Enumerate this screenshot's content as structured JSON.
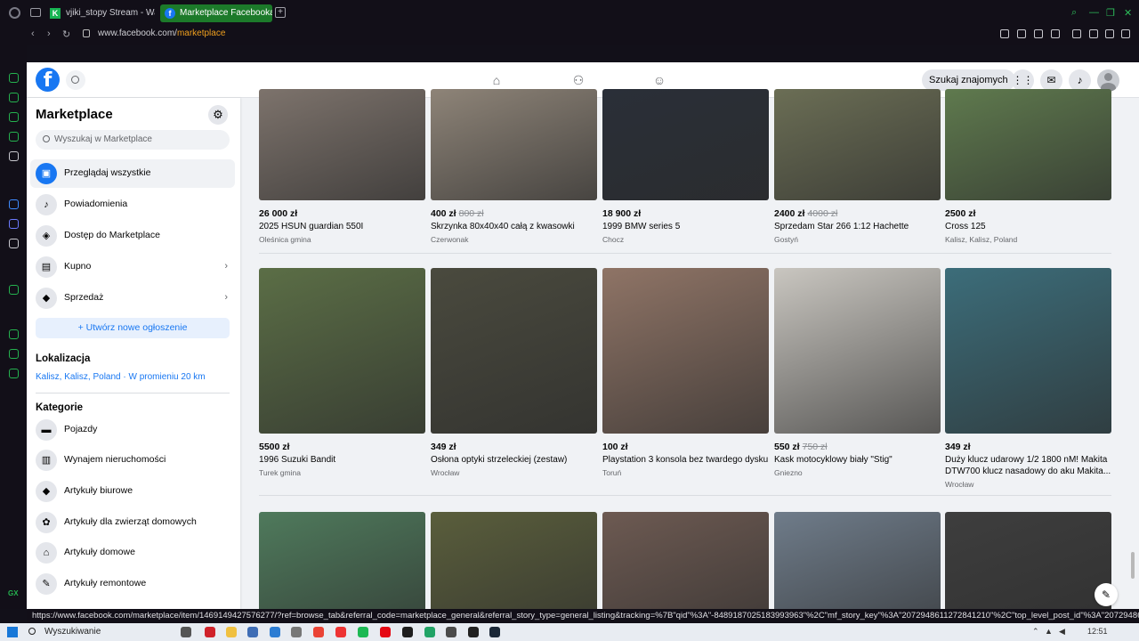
{
  "browser": {
    "tabs": [
      {
        "label": "vjiki_stopy Stream - Watch",
        "favicon": "K"
      },
      {
        "label": "Marketplace Facebooka",
        "favicon": "f",
        "active": true
      }
    ],
    "url_host": "www.facebook.com/",
    "url_path": "marketplace",
    "status_url": "https://www.facebook.com/marketplace/item/1469149427576277/?ref=browse_tab&referral_code=marketplace_general&referral_story_type=general_listing&tracking=%7B\"qid\"%3A\"-8489187025183993963\"%2C\"mf_story_key\"%3A\"2072948611272841210\"%2C\"top_level_post_id\"%3A\"2072948611"
  },
  "header": {
    "logo": "f",
    "find_friends": "Szukaj znajomych"
  },
  "sidebar": {
    "title": "Marketplace",
    "search_placeholder": "Wyszukaj w Marketplace",
    "nav": [
      {
        "label": "Przeglądaj wszystkie"
      },
      {
        "label": "Powiadomienia"
      },
      {
        "label": "Dostęp do Marketplace"
      },
      {
        "label": "Kupno"
      },
      {
        "label": "Sprzedaż"
      }
    ],
    "create_button": "Utwórz nowe ogłoszenie",
    "location_heading": "Lokalizacja",
    "location_value": "Kalisz, Kalisz, Poland · W promieniu 20 km",
    "categories_heading": "Kategorie",
    "categories": [
      {
        "label": "Pojazdy"
      },
      {
        "label": "Wynajem nieruchomości"
      },
      {
        "label": "Artykuły biurowe"
      },
      {
        "label": "Artykuły dla zwierząt domowych"
      },
      {
        "label": "Artykuły domowe"
      },
      {
        "label": "Artykuły remontowe"
      }
    ]
  },
  "listings": [
    {
      "price": "26 000 zł",
      "old_price": "",
      "title": "2025 HSUN guardian 550I",
      "location": "Oleśnica gmina",
      "color": "#7d736c"
    },
    {
      "price": "400 zł",
      "old_price": "800 zł",
      "title": "Skrzynka 80x40x40 całą z kwasowki",
      "location": "Czerwonak",
      "color": "#8e8478"
    },
    {
      "price": "18 900 zł",
      "old_price": "",
      "title": "1999 BMW series 5",
      "location": "Chocz",
      "color": "#2a2f38"
    },
    {
      "price": "2400 zł",
      "old_price": "4000 zł",
      "title": "Sprzedam Star 266 1:12 Hachette",
      "location": "Gostyń",
      "color": "#6b6e55"
    },
    {
      "price": "2500 zł",
      "old_price": "",
      "title": "Cross 125",
      "location": "Kalisz, Kalisz, Poland",
      "color": "#5f7a4e"
    },
    {
      "price": "5500 zł",
      "old_price": "",
      "title": "1996 Suzuki Bandit",
      "location": "Turek gmina",
      "color": "#5b6e46"
    },
    {
      "price": "349 zł",
      "old_price": "",
      "title": "Osłona optyki strzeleckiej (zestaw)",
      "location": "Wrocław",
      "color": "#4a4a3e"
    },
    {
      "price": "100 zł",
      "old_price": "",
      "title": "Playstation 3 konsola bez twardego dysku",
      "location": "Toruń",
      "color": "#8f7466"
    },
    {
      "price": "550 zł",
      "old_price": "750 zł",
      "title": "Kask motocyklowy biały \"Stig\"",
      "location": "Gniezno",
      "color": "#c9c6c0"
    },
    {
      "price": "349 zł",
      "old_price": "",
      "title": "Duży klucz udarowy 1/2 1800 nM! Makita DTW700 klucz nasadowy do aku Makita...",
      "location": "Wrocław",
      "color": "#3c6d7a"
    },
    {
      "price": "",
      "old_price": "",
      "title": "",
      "location": "",
      "color": "#4f7a5c"
    },
    {
      "price": "",
      "old_price": "",
      "title": "",
      "location": "",
      "color": "#5a5e3c"
    },
    {
      "price": "",
      "old_price": "",
      "title": "",
      "location": "",
      "color": "#6d5a52"
    },
    {
      "price": "",
      "old_price": "",
      "title": "",
      "location": "",
      "color": "#6f7c8a"
    },
    {
      "price": "",
      "old_price": "",
      "title": "",
      "location": "",
      "color": "#3e3e3e"
    }
  ],
  "taskbar": {
    "search_placeholder": "Wyszukiwanie",
    "time": "12:51"
  },
  "colors": {
    "fb_blue": "#1877f2",
    "opera_green": "#25b24f"
  }
}
